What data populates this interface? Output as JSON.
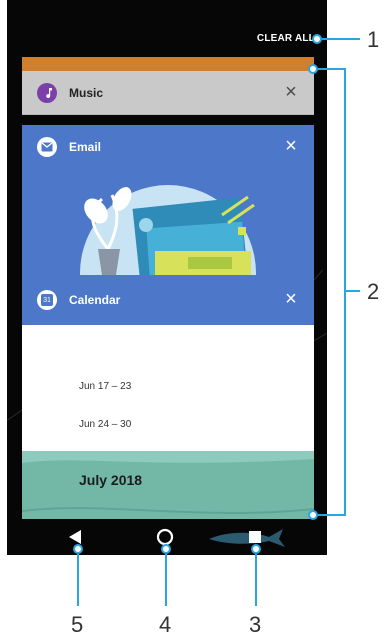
{
  "recents": {
    "clear_all_label": "CLEAR ALL",
    "cards": {
      "music": {
        "label": "Music",
        "icon": "music-note-icon",
        "color": "#7b3fa8"
      },
      "email": {
        "label": "Email",
        "icon": "envelope-icon",
        "color": "#4d77c8"
      },
      "calendar": {
        "label": "Calendar",
        "icon": "calendar-icon",
        "icon_text": "31",
        "weeks": [
          "Jun 17 – 23",
          "Jun 24 – 30"
        ],
        "month": "July 2018"
      }
    }
  },
  "navigation": {
    "back": "back-icon",
    "home": "home-icon",
    "recents": "recent-apps-icon"
  },
  "callouts": [
    "1",
    "2",
    "3",
    "4",
    "5"
  ],
  "colors": {
    "callout_blue": "#29a6df",
    "card_blue": "#4d77c8",
    "orange": "#d07f2c"
  }
}
